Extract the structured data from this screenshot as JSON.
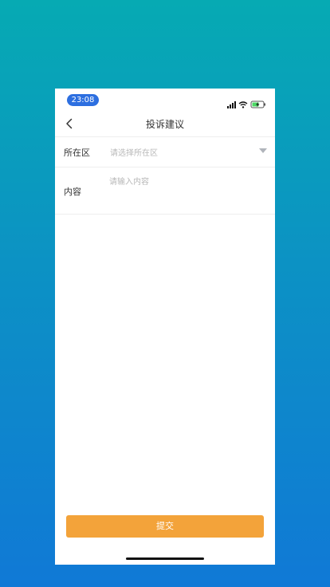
{
  "status_bar": {
    "time": "23:08",
    "icons": [
      "signal-icon",
      "wifi-icon",
      "battery-charging-icon"
    ]
  },
  "nav": {
    "title": "投诉建议",
    "back_icon": "chevron-left-icon"
  },
  "form": {
    "district_label": "所在区",
    "district_placeholder": "请选择所在区",
    "content_label": "内容",
    "content_placeholder": "请输入内容"
  },
  "submit_label": "提交",
  "colors": {
    "accent": "#f3a33a",
    "time_pill": "#2d6fe0",
    "battery": "#4cd964"
  }
}
